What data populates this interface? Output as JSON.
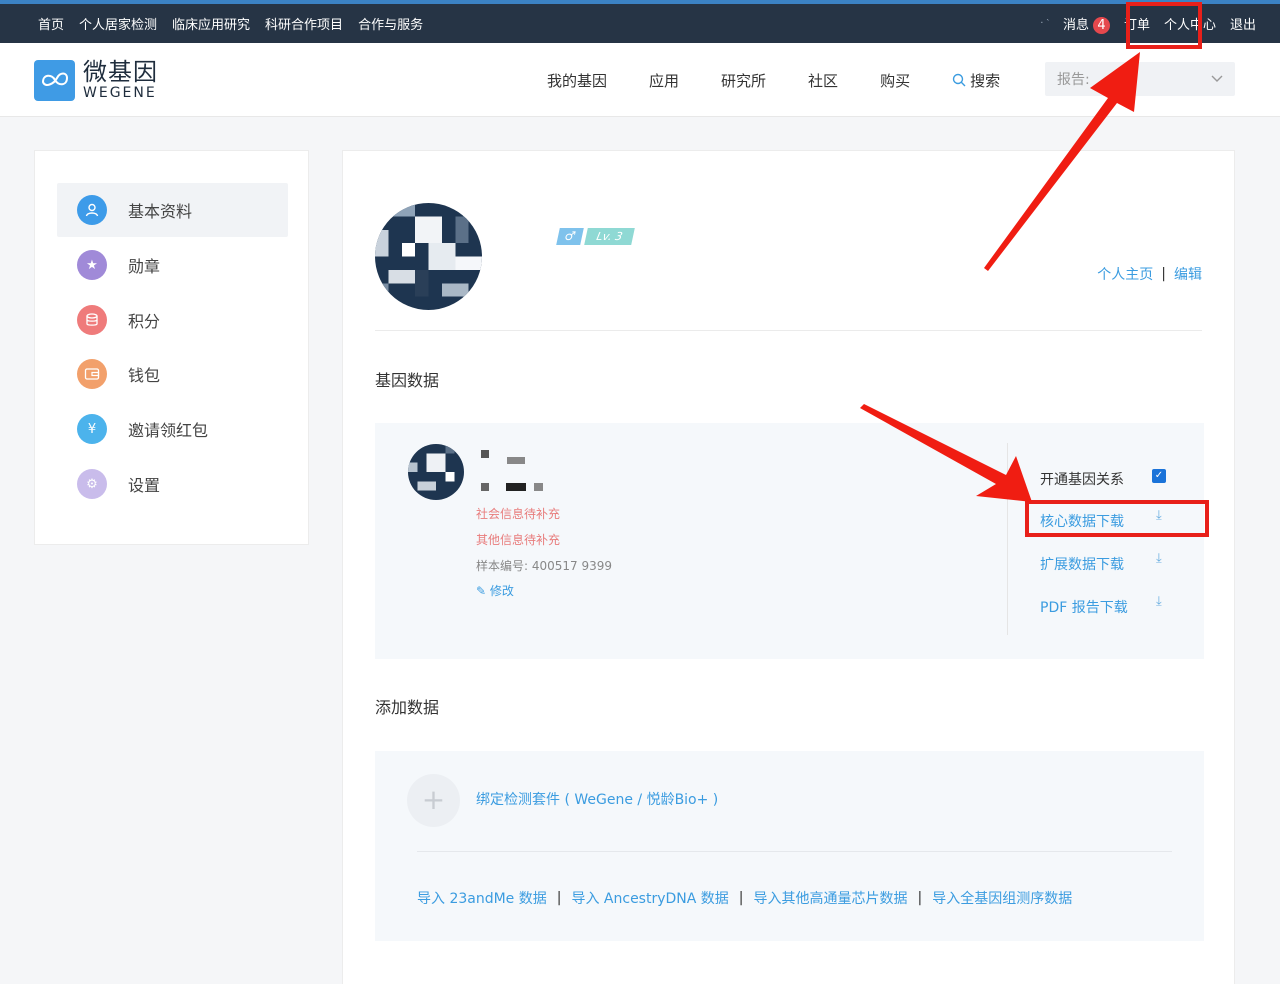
{
  "topbar": {
    "nav": [
      "首页",
      "个人居家检测",
      "临床应用研究",
      "科研合作项目",
      "合作与服务"
    ],
    "dots": "·  ‵",
    "messages_label": "消息",
    "messages_count": "4",
    "orders_label": "订单",
    "personal_center_label": "个人中心",
    "logout_label": "退出"
  },
  "header": {
    "logo_cn": "微基因",
    "logo_en": "WEGENE",
    "nav": [
      "我的基因",
      "应用",
      "研究所",
      "社区",
      "购买"
    ],
    "search_label": "搜索",
    "report_label": "报告:"
  },
  "sidebar": {
    "items": [
      {
        "label": "基本资料",
        "icon": "user-icon",
        "color": "#3d9be9"
      },
      {
        "label": "勋章",
        "icon": "star-badge-icon",
        "color": "#a08ad8"
      },
      {
        "label": "积分",
        "icon": "coin-stack-icon",
        "color": "#ef7b7b"
      },
      {
        "label": "钱包",
        "icon": "wallet-icon",
        "color": "#f2a06b"
      },
      {
        "label": "邀请领红包",
        "icon": "yuan-icon",
        "color": "#4cb3ec"
      },
      {
        "label": "设置",
        "icon": "gear-icon",
        "color": "#b9a8e0"
      }
    ]
  },
  "profile": {
    "username": "",
    "gender_symbol": "♂",
    "level": "Lv. 3",
    "homepage_link": "个人主页",
    "separator": "|",
    "edit_link": "编辑"
  },
  "gene_data": {
    "title": "基因数据",
    "social_info": "社会信息待补充",
    "other_info": "其他信息待补充",
    "sample_no": "样本编号: 400517    9399",
    "edit_label": "修改",
    "relation_label": "开通基因关系",
    "relation_checked": true,
    "downloads": [
      "核心数据下载",
      "扩展数据下载",
      "PDF 报告下载"
    ]
  },
  "add_data": {
    "title": "添加数据",
    "bind_kit": "绑定检测套件 ( WeGene / 悦龄Bio+ )",
    "imports": [
      "导入 23andMe 数据",
      "导入 AncestryDNA 数据",
      "导入其他高通量芯片数据",
      "导入全基因组测序数据"
    ],
    "separator": "|"
  },
  "colors": {
    "topbar_bg": "#263445",
    "link_blue": "#3b9ce0",
    "annotation_red": "#e8201a",
    "warning_red": "#e87c7c"
  }
}
